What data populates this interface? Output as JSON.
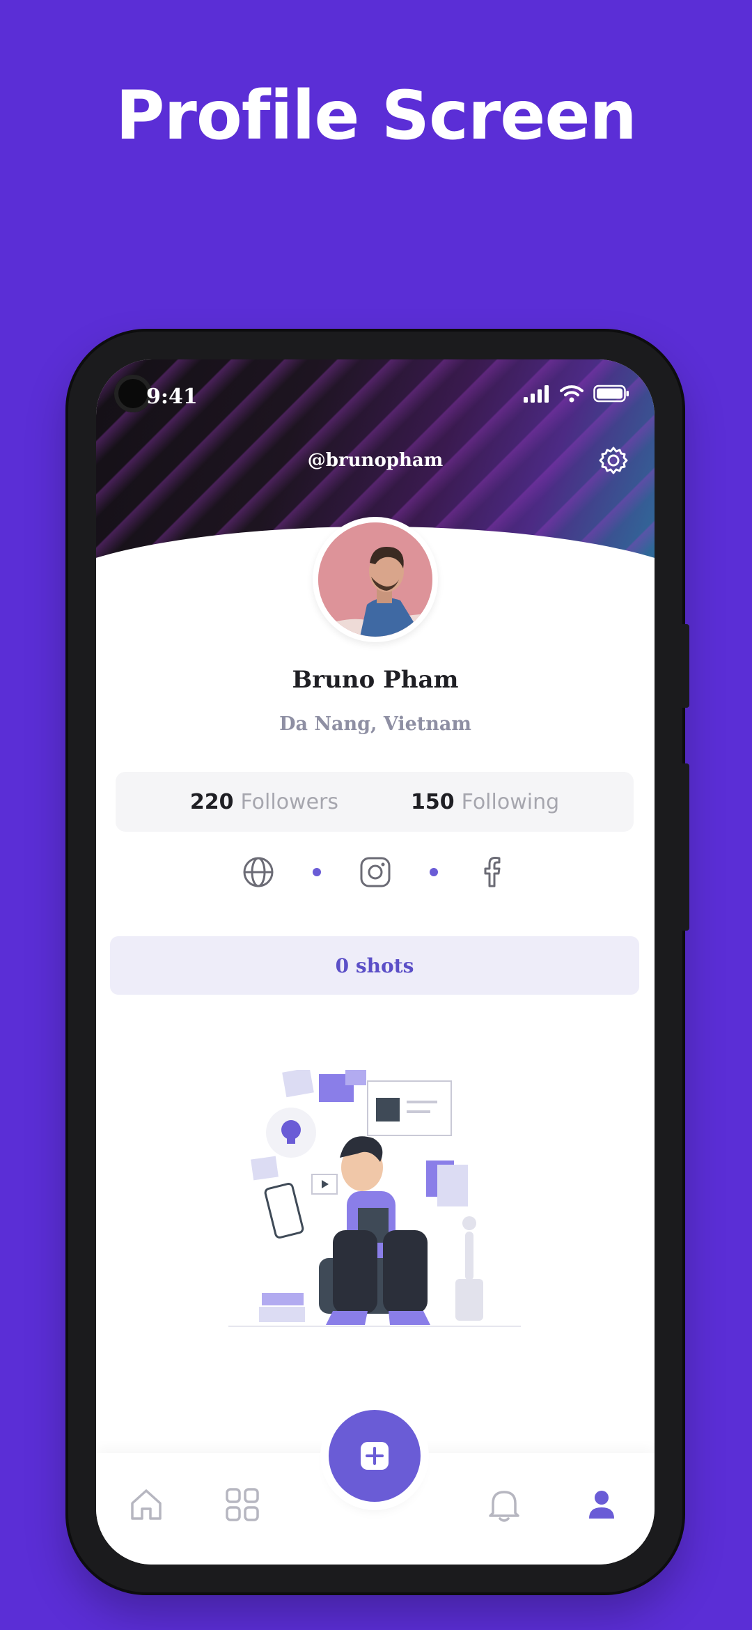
{
  "headline": "Profile Screen",
  "status_bar": {
    "time": "9:41",
    "icons": [
      "signal-icon",
      "wifi-icon",
      "battery-icon"
    ]
  },
  "profile": {
    "username": "@brunopham",
    "name": "Bruno Pham",
    "location": "Da Nang, Vietnam",
    "followers_count": "220",
    "followers_label": "Followers",
    "following_count": "150",
    "following_label": "Following",
    "socials": [
      "globe-icon",
      "instagram-icon",
      "facebook-icon"
    ],
    "shots_label": "0 shots"
  },
  "tabbar": {
    "items": [
      "home-icon",
      "grid-icon",
      "add-icon",
      "bell-icon",
      "profile-icon"
    ],
    "active": "profile-icon"
  },
  "colors": {
    "background": "#5b2ed6",
    "accent": "#6a5cd6",
    "shots_bg": "#eeedf9",
    "stats_bg": "#f5f5f7"
  }
}
